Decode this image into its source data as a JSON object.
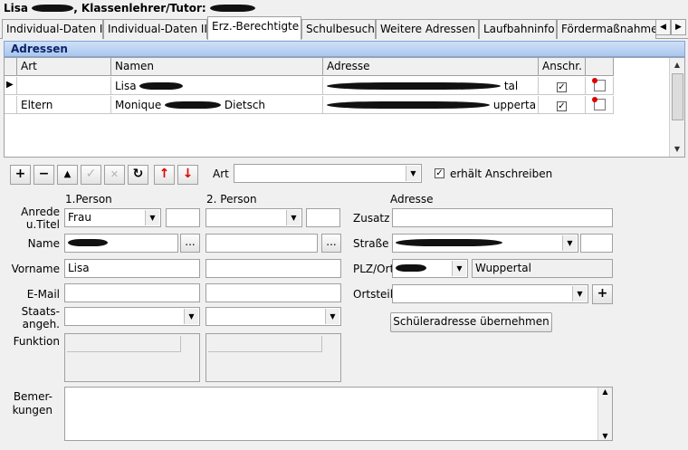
{
  "title": {
    "name_first": "Lisa",
    "role_text": ", Klassenlehrer/Tutor:"
  },
  "tabs": [
    {
      "label": "Individual-Daten I"
    },
    {
      "label": "Individual-Daten II"
    },
    {
      "label": "Erz.-Berechtigte"
    },
    {
      "label": "Schulbesuch"
    },
    {
      "label": "Weitere Adressen"
    },
    {
      "label": "Laufbahninfo"
    },
    {
      "label": "Fördermaßnahme"
    }
  ],
  "section": {
    "title": "Adressen"
  },
  "table": {
    "headers": {
      "art": "Art",
      "namen": "Namen",
      "adresse": "Adresse",
      "anschr": "Anschr."
    },
    "rows": [
      {
        "art": "",
        "namen": "Lisa",
        "adresse_tail": "tal",
        "anschr": "✓"
      },
      {
        "art": "Eltern",
        "namen": "Monique",
        "namen_tail": "Dietsch",
        "adresse_tail": "upperta",
        "anschr": "✓"
      }
    ]
  },
  "toolbar": {
    "add": "+",
    "remove": "−",
    "up": "▲",
    "check": "✓",
    "cancel": "✕",
    "refresh": "↻",
    "move_up": "↑",
    "move_down": "↓",
    "art_label": "Art",
    "art_value": "",
    "erhaelt_label": "erhält Anschreiben",
    "erhaelt_checked": "✓"
  },
  "form": {
    "person1_header": "1.Person",
    "person2_header": "2. Person",
    "adresse_header": "Adresse",
    "anrede_label": "Anrede\nu.Titel",
    "name_label": "Name",
    "vorname_label": "Vorname",
    "email_label": "E-Mail",
    "staats_label": "Staats-\nangeh.",
    "funktion_label": "Funktion",
    "bemerkungen_label": "Bemer-\nkungen",
    "p1_anrede": "Frau",
    "p1_vorname": "Lisa",
    "dots": "...",
    "zusatz_label": "Zusatz",
    "strasse_label": "Straße",
    "plz_label": "PLZ/Ort",
    "ort_value": "Wuppertal",
    "ortsteil_label": "Ortsteil",
    "ortsteil_add": "+",
    "uebernehmen_button": "Schüleradresse übernehmen"
  }
}
